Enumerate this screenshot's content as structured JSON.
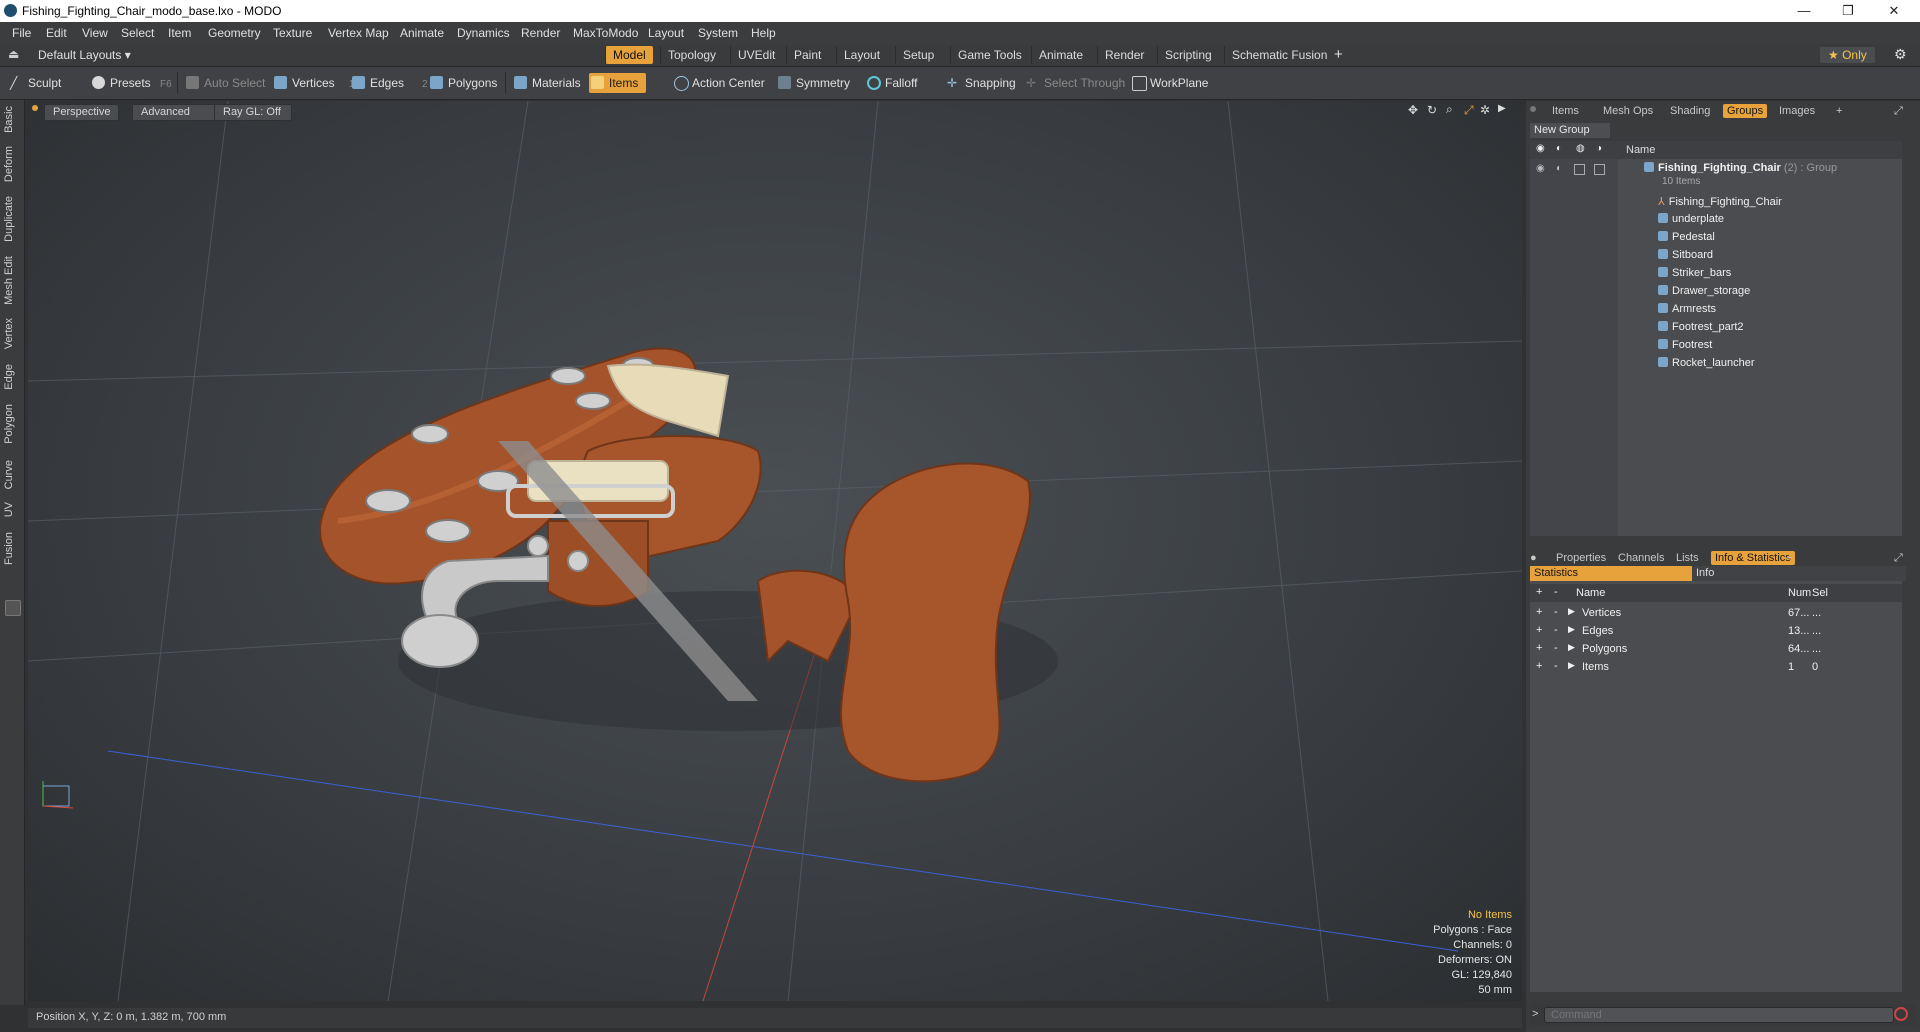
{
  "window": {
    "title": "Fishing_Fighting_Chair_modo_base.lxo - MODO",
    "controls": [
      "—",
      "❐",
      "✕"
    ]
  },
  "menu": [
    "File",
    "Edit",
    "View",
    "Select",
    "Item",
    "Geometry",
    "Texture",
    "Vertex Map",
    "Animate",
    "Dynamics",
    "Render",
    "MaxToModo",
    "Layout",
    "System",
    "Help"
  ],
  "layout_bar": {
    "layout_selector": "Default Layouts ▾",
    "tabs": [
      "Model",
      "Topology",
      "UVEdit",
      "Paint",
      "Layout",
      "Setup",
      "Game Tools",
      "Animate",
      "Render",
      "Scripting",
      "Schematic Fusion"
    ],
    "active_tab": "Model",
    "add": "+",
    "only_label": "★  Only",
    "gear": "⚙"
  },
  "toolbar": {
    "sculpt": "Sculpt",
    "presets": "Presets",
    "presets_key": "F6",
    "auto_select": "Auto Select",
    "vertices": "Vertices",
    "vertices_count": "1",
    "edges": "Edges",
    "edges_count": "2",
    "polygons": "Polygons",
    "materials": "Materials",
    "items": "Items",
    "action_center": "Action Center",
    "symmetry": "Symmetry",
    "falloff": "Falloff",
    "snapping": "Snapping",
    "select_through": "Select Through",
    "workplane": "WorkPlane"
  },
  "left_tabs": [
    "Basic",
    "Deform",
    "Duplicate",
    "Mesh Edit",
    "Vertex",
    "Edge",
    "Polygon",
    "Curve",
    "UV",
    "Fusion"
  ],
  "viewport": {
    "view_mode": "Perspective",
    "shading": "Advanced",
    "ray_gl": "Ray GL: Off",
    "info": {
      "selection": "No Items",
      "polygons": "Polygons : Face",
      "channels": "Channels: 0",
      "deformers": "Deformers: ON",
      "gl": "GL: 129,840",
      "scale": "50 mm"
    }
  },
  "status_bar": {
    "position": "Position X, Y, Z:   0 m, 1.382 m, 700 mm"
  },
  "groups_panel": {
    "tabs": [
      "Items",
      "Mesh Ops",
      "Shading",
      "Groups",
      "Images"
    ],
    "active_tab": "Groups",
    "new_group": "New Group",
    "column_name": "Name",
    "group_name": "Fishing_Fighting_Chair",
    "group_suffix": "(2) : Group",
    "group_count": "10 Items",
    "items": [
      "Fishing_Fighting_Chair",
      "underplate",
      "Pedestal",
      "Sitboard",
      "Striker_bars",
      "Drawer_storage",
      "Armrests",
      "Footrest_part2",
      "Footrest",
      "Rocket_launcher"
    ]
  },
  "stats_panel": {
    "tabs": [
      "Properties",
      "Channels",
      "Lists",
      "Info & Statistics"
    ],
    "active_tab": "Info & Statistics",
    "subtabs": [
      "Statistics",
      "Info"
    ],
    "columns": {
      "name": "Name",
      "num": "Num",
      "sel": "Sel"
    },
    "rows": [
      {
        "name": "Vertices",
        "num": "67...",
        "sel": "..."
      },
      {
        "name": "Edges",
        "num": "13...",
        "sel": "..."
      },
      {
        "name": "Polygons",
        "num": "64...",
        "sel": "..."
      },
      {
        "name": "Items",
        "num": "1",
        "sel": "0"
      }
    ]
  },
  "command": {
    "placeholder": "Command",
    "prompt": ">"
  }
}
